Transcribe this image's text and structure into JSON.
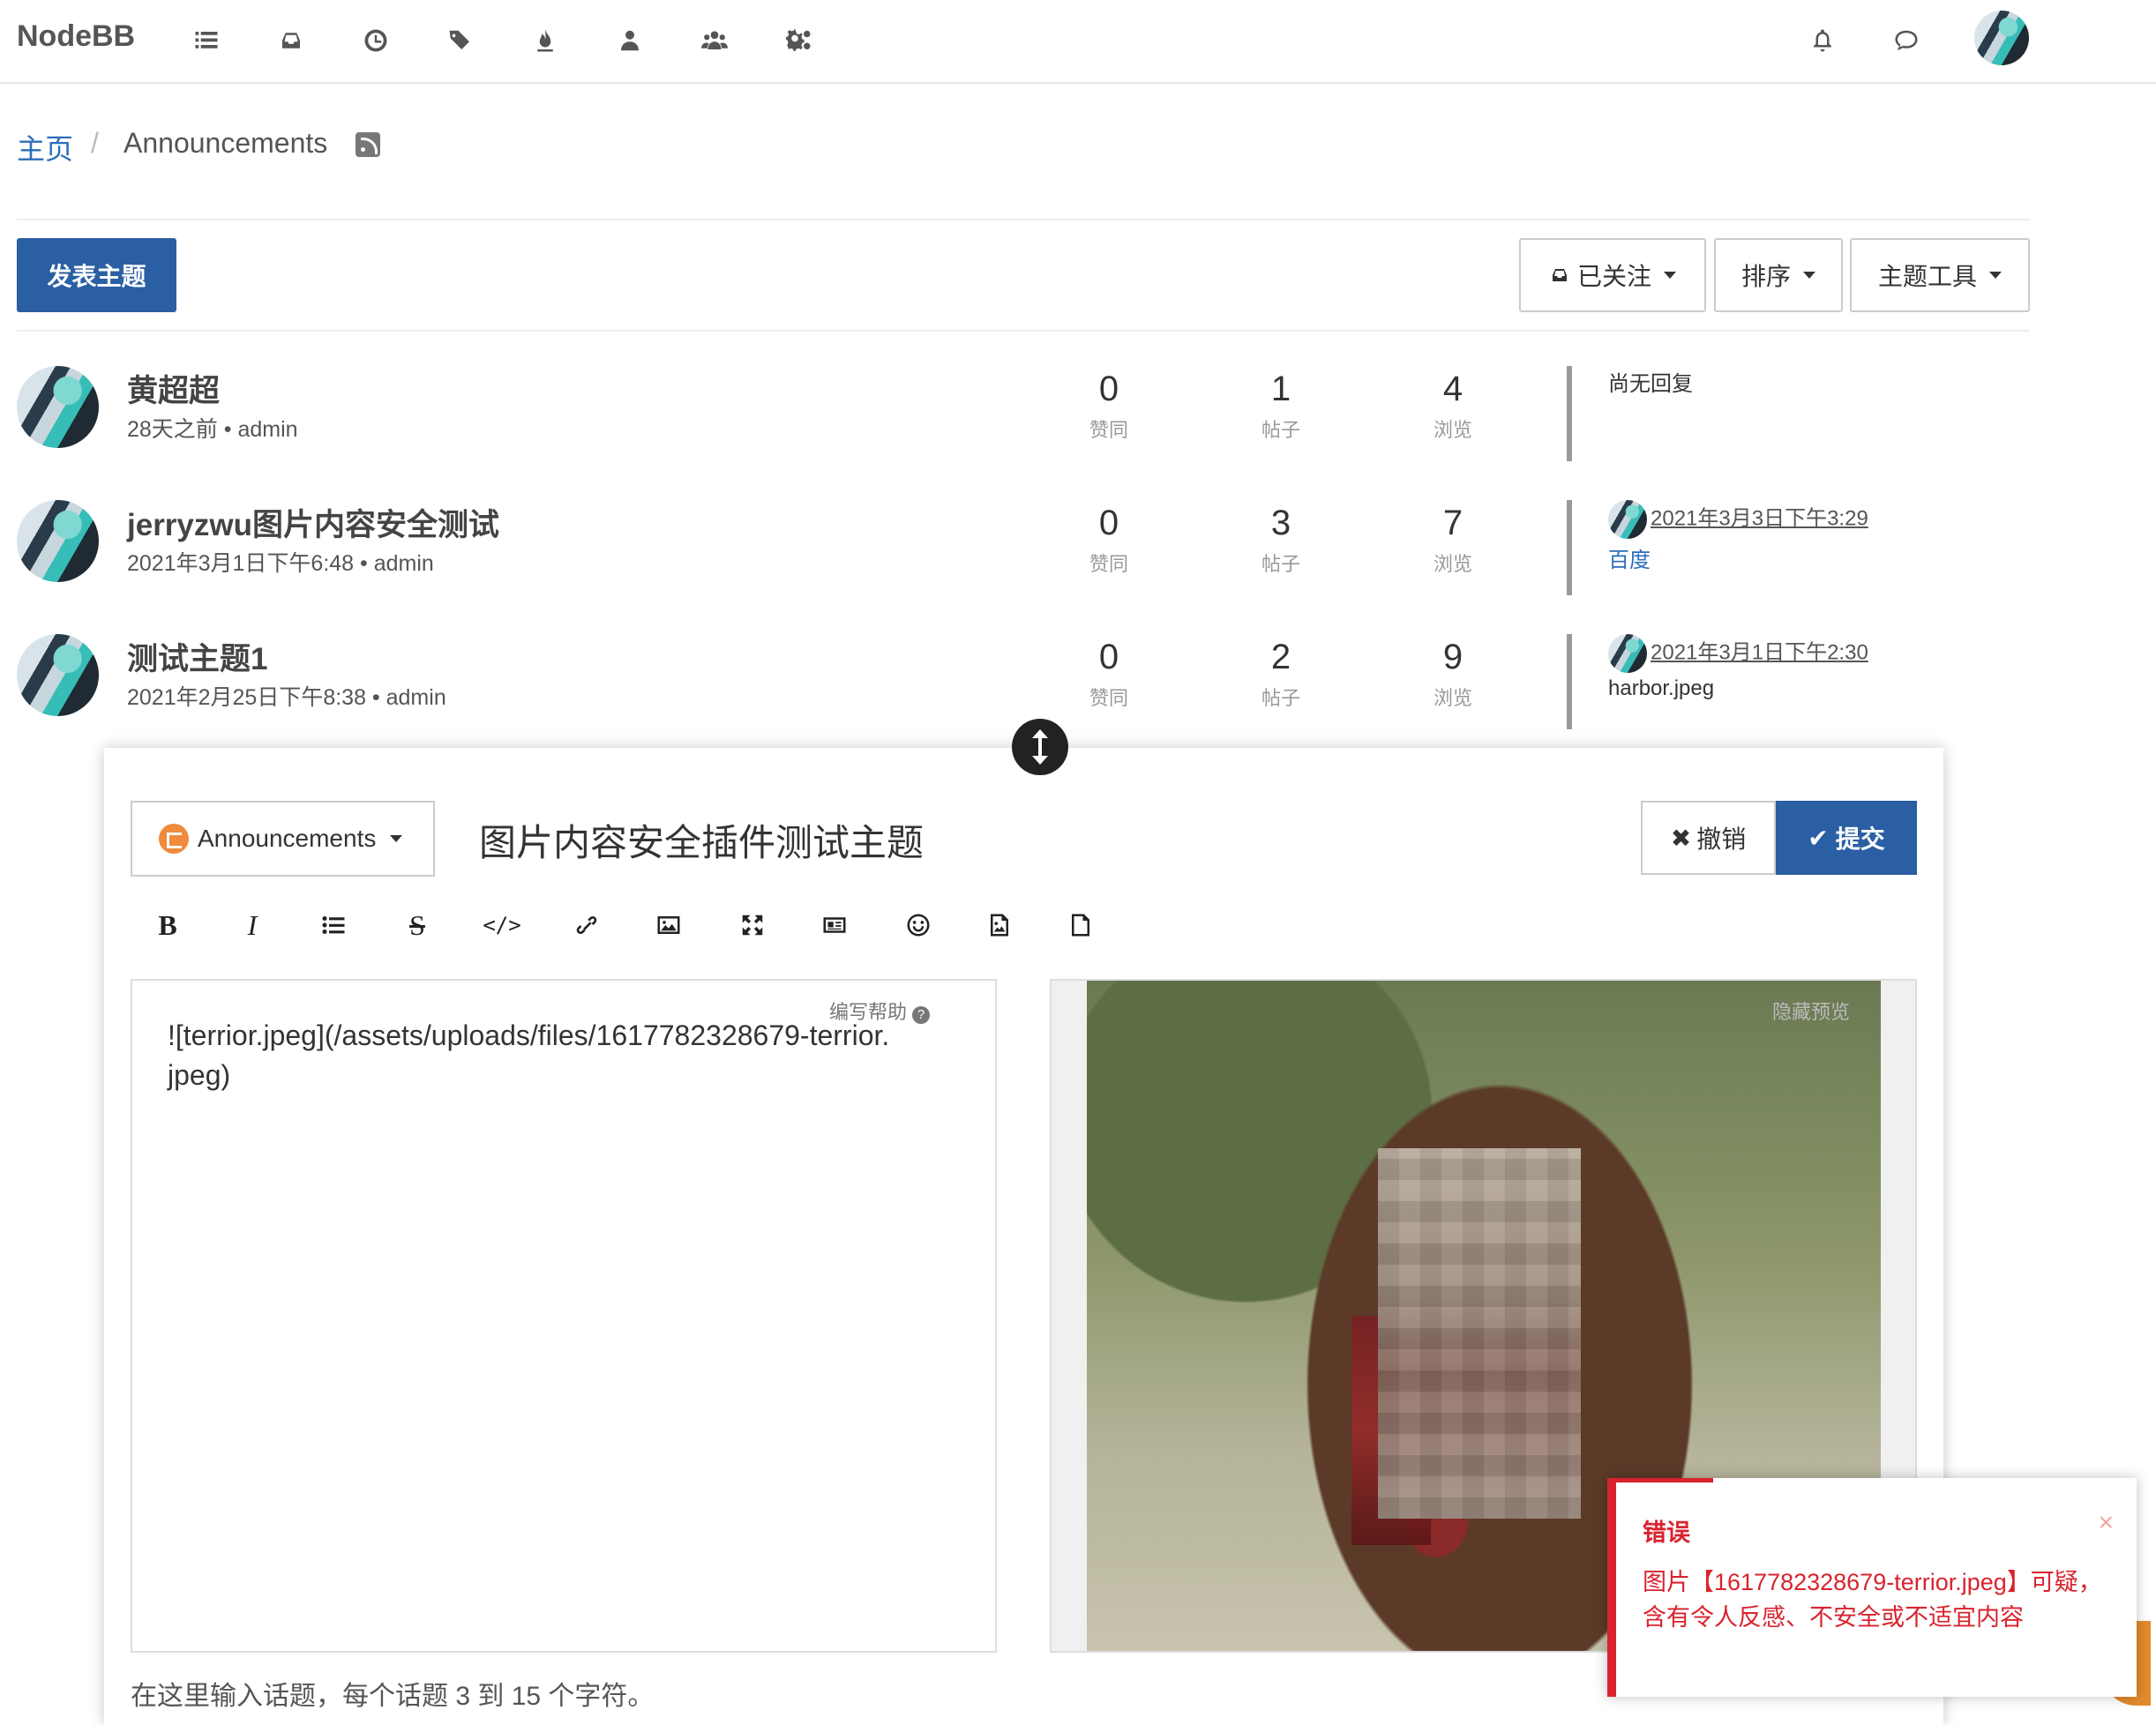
{
  "navbar": {
    "brand": "NodeBB",
    "icons": [
      "categories-icon",
      "unread-icon",
      "recent-icon",
      "tags-icon",
      "popular-icon",
      "users-icon",
      "groups-icon",
      "admin-icon"
    ],
    "right_icons": [
      "notifications-icon",
      "chats-icon",
      "user-avatar"
    ]
  },
  "breadcrumb": {
    "home": "主页",
    "separator": "/",
    "current": "Announcements"
  },
  "toolbar": {
    "new_topic": "发表主题",
    "watching": "已关注",
    "sort": "排序",
    "topic_tools": "主题工具"
  },
  "topics": [
    {
      "title": "黄超超",
      "meta": "28天之前 • admin",
      "votes": "0",
      "votes_label": "赞同",
      "posts": "1",
      "posts_label": "帖子",
      "views": "4",
      "views_label": "浏览",
      "last_reply_time": "",
      "last_reply_text": "尚无回复"
    },
    {
      "title": "jerryzwu图片内容安全测试",
      "meta": "2021年3月1日下午6:48 • admin",
      "votes": "0",
      "votes_label": "赞同",
      "posts": "3",
      "posts_label": "帖子",
      "views": "7",
      "views_label": "浏览",
      "last_reply_time": "2021年3月3日下午3:29",
      "last_reply_text": "百度"
    },
    {
      "title": "测试主题1",
      "meta": "2021年2月25日下午8:38 • admin",
      "votes": "0",
      "votes_label": "赞同",
      "posts": "2",
      "posts_label": "帖子",
      "views": "9",
      "views_label": "浏览",
      "last_reply_time": "2021年3月1日下午2:30",
      "last_reply_text": "harbor.jpeg"
    }
  ],
  "composer": {
    "category": "Announcements",
    "title": "图片内容安全插件测试主题",
    "discard": "撤销",
    "submit": "提交",
    "formatting": [
      "bold-icon",
      "italic-icon",
      "list-icon",
      "strikethrough-icon",
      "code-icon",
      "link-icon",
      "picture-icon",
      "fullscreen-icon",
      "card-icon",
      "emoji-icon",
      "upload-image-icon",
      "upload-file-icon"
    ],
    "help": "编写帮助",
    "content": "![terrior.jpeg](/assets/uploads/files/1617782328679-terrior.jpeg)",
    "hide_preview": "隐藏预览",
    "tags_hint": "在这里输入话题，每个话题 3 到 15 个字符。"
  },
  "toast": {
    "title": "错误",
    "message": "图片【1617782328679-terrior.jpeg】可疑，含有令人反感、不安全或不适宜内容",
    "close": "×"
  }
}
